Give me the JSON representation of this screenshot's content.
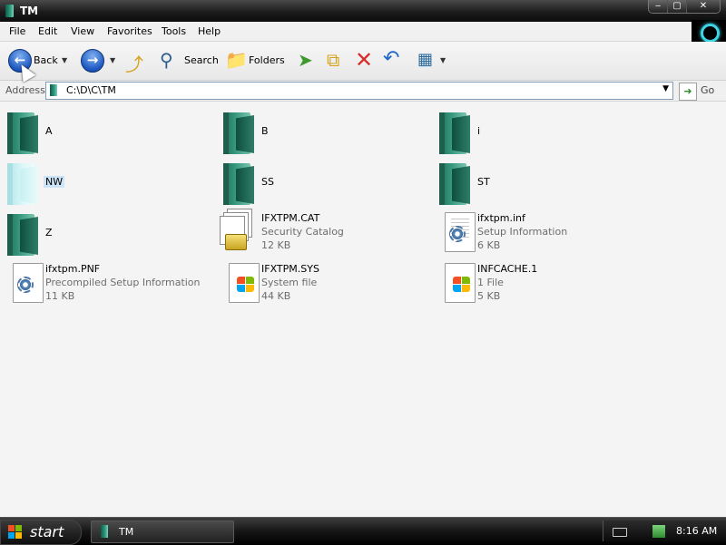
{
  "window": {
    "title": "TM"
  },
  "window_buttons": {
    "minimize": "‒",
    "maximize": "▢",
    "close": "✕"
  },
  "menu": [
    "File",
    "Edit",
    "View",
    "Favorites",
    "Tools",
    "Help"
  ],
  "toolbar": {
    "back": "Back",
    "search": "Search",
    "folders": "Folders"
  },
  "address": {
    "label": "Address",
    "value": "C:\\D\\C\\TM",
    "go": "Go"
  },
  "items": [
    {
      "name": "A",
      "kind": "folder"
    },
    {
      "name": "B",
      "kind": "folder"
    },
    {
      "name": "i",
      "kind": "folder"
    },
    {
      "name": "NW",
      "kind": "folder-light",
      "selected": true
    },
    {
      "name": "SS",
      "kind": "folder"
    },
    {
      "name": "ST",
      "kind": "folder"
    },
    {
      "name": "Z",
      "kind": "folder"
    },
    {
      "name": "IFXTPM.CAT",
      "type": "Security Catalog",
      "size": "12 KB",
      "kind": "catalog"
    },
    {
      "name": "ifxtpm.inf",
      "type": "Setup Information",
      "size": "6 KB",
      "kind": "setup"
    },
    {
      "name": "ifxtpm.PNF",
      "type": "Precompiled Setup Information",
      "size": "11 KB",
      "kind": "setup-plain"
    },
    {
      "name": "IFXTPM.SYS",
      "type": "System file",
      "size": "44 KB",
      "kind": "sys"
    },
    {
      "name": "INFCACHE.1",
      "type": "1 File",
      "size": "5 KB",
      "kind": "sys"
    }
  ],
  "taskbar": {
    "start": "start",
    "task_label": "TM",
    "clock": "8:16 AM"
  }
}
